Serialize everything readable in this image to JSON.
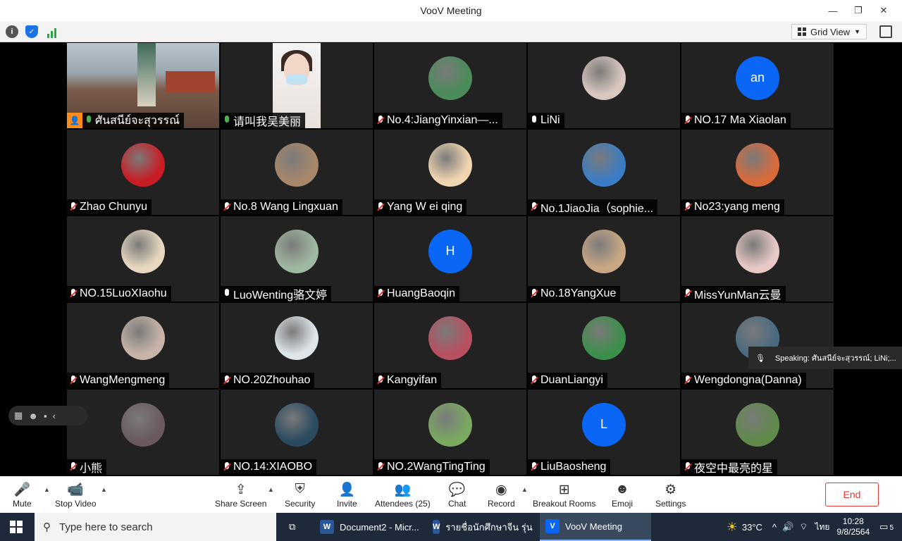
{
  "window": {
    "title": "VooV Meeting"
  },
  "subbar": {
    "view_label": "Grid View"
  },
  "tiles": [
    {
      "name": "ศันสนีย์จะสุวรรณ์",
      "type": "video1",
      "mic": "on",
      "host": true
    },
    {
      "name": "请叫我吴美丽",
      "type": "video2",
      "mic": "on"
    },
    {
      "name": "No.4:JiangYinxian—...",
      "type": "avatar",
      "color": "#4a8c5a",
      "mic": "muted"
    },
    {
      "name": "LiNi",
      "type": "avatar",
      "color": "#d9c7c0",
      "mic": "on-white"
    },
    {
      "name": "NO.17 Ma Xiaolan",
      "type": "letter",
      "letter": "an",
      "color": "#0a66f5",
      "mic": "muted"
    },
    {
      "name": "Zhao Chunyu",
      "type": "avatar",
      "color": "#c81d25",
      "mic": "muted"
    },
    {
      "name": "No.8 Wang Lingxuan",
      "type": "avatar",
      "color": "#a8866a",
      "mic": "muted"
    },
    {
      "name": "Yang W ei qing",
      "type": "avatar",
      "color": "#f0d5b0",
      "mic": "muted"
    },
    {
      "name": "No.1JiaoJia（sophie...",
      "type": "avatar",
      "color": "#3b7dc4",
      "mic": "muted"
    },
    {
      "name": "No23:yang meng",
      "type": "avatar",
      "color": "#d86a3a",
      "mic": "muted"
    },
    {
      "name": "NO.15LuoXIaohu",
      "type": "avatar",
      "color": "#e8d8c0",
      "mic": "muted"
    },
    {
      "name": "LuoWenting骆文婷",
      "type": "avatar",
      "color": "#9fb8a0",
      "mic": "on-white"
    },
    {
      "name": "HuangBaoqin",
      "type": "letter",
      "letter": "H",
      "color": "#0a66f5",
      "mic": "muted"
    },
    {
      "name": "No.18YangXue",
      "type": "avatar",
      "color": "#c9a784",
      "mic": "muted"
    },
    {
      "name": "MissYunMan云曼",
      "type": "avatar",
      "color": "#e8c8c4",
      "mic": "muted"
    },
    {
      "name": "WangMengmeng",
      "type": "avatar",
      "color": "#c8b4a8",
      "mic": "muted"
    },
    {
      "name": "NO.20Zhouhao",
      "type": "avatar",
      "color": "#dfe6ea",
      "mic": "muted"
    },
    {
      "name": "Kangyifan",
      "type": "avatar",
      "color": "#b85060",
      "mic": "muted"
    },
    {
      "name": "DuanLiangyi",
      "type": "avatar",
      "color": "#3c8f4a",
      "mic": "muted"
    },
    {
      "name": "Wengdongna(Danna)",
      "type": "avatar",
      "color": "#4a6a80",
      "mic": "muted"
    },
    {
      "name": "小熊",
      "type": "avatar",
      "color": "#6a5a60",
      "mic": "muted"
    },
    {
      "name": "NO.14:XIAOBO",
      "type": "avatar",
      "color": "#2a4a60",
      "mic": "muted"
    },
    {
      "name": "NO.2WangTingTing",
      "type": "avatar",
      "color": "#7aa860",
      "mic": "muted"
    },
    {
      "name": "LiuBaosheng",
      "type": "letter",
      "letter": "L",
      "color": "#0a66f5",
      "mic": "muted"
    },
    {
      "name": "夜空中最亮的星",
      "type": "avatar",
      "color": "#5f8a4a",
      "mic": "muted"
    }
  ],
  "speaking": "Speaking: ศันสนีย์จะสุวรรณ์; LiNi;...",
  "toolbar": {
    "mute": "Mute",
    "stop_video": "Stop Video",
    "share": "Share Screen",
    "security": "Security",
    "invite": "Invite",
    "attendees": "Attendees (25)",
    "chat": "Chat",
    "record": "Record",
    "breakout": "Breakout Rooms",
    "emoji": "Emoji",
    "settings": "Settings",
    "end": "End"
  },
  "taskbar": {
    "search_placeholder": "Type here to search",
    "tasks": [
      "Document2 - Micr...",
      "รายชื่อนักศึกษาจีน รุ่น ...",
      "VooV Meeting"
    ],
    "temp": "33°C",
    "lang": "ไทย",
    "time": "10:28",
    "date": "9/8/2564",
    "notif_count": "5"
  }
}
